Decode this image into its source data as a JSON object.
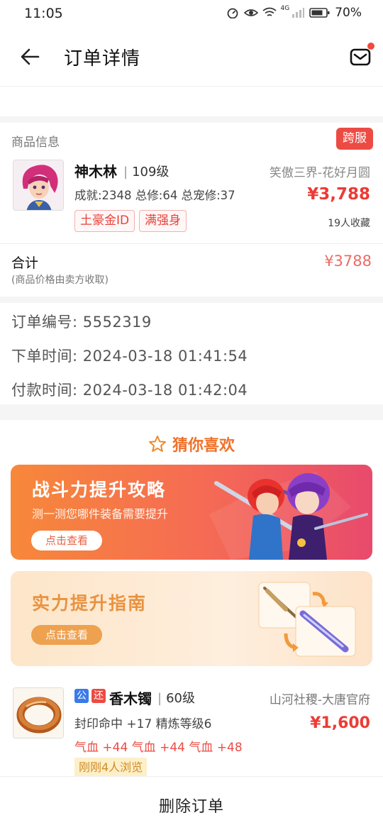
{
  "status_bar": {
    "time": "11:05",
    "network": "4G",
    "battery": "70%"
  },
  "header": {
    "title": "订单详情"
  },
  "product": {
    "section_label": "商品信息",
    "cross_badge": "跨服",
    "name": "神木林",
    "level": "109级",
    "server": "笑傲三界-花好月圆",
    "stats": "成就:2348 总修:64 总宠修:37",
    "price": "¥3,788",
    "tags": [
      "土豪金ID",
      "满强身"
    ],
    "favorites": "19人收藏"
  },
  "total": {
    "label": "合计",
    "note": "(商品价格由卖方收取)",
    "value": "¥3788"
  },
  "order_info": {
    "order_no": "订单编号:  5552319",
    "order_time": "下单时间:  2024-03-18 01:41:54",
    "pay_time": "付款时间:  2024-03-18 01:42:04"
  },
  "recommend": {
    "title": "猜你喜欢",
    "banners": [
      {
        "title": "战斗力提升攻略",
        "subtitle": "测一测您哪件装备需要提升",
        "button": "点击查看"
      },
      {
        "title": "实力提升指南",
        "button": "点击查看"
      }
    ],
    "item": {
      "badges": [
        "公",
        "还"
      ],
      "name": "香木镯",
      "level": "60级",
      "server": "山河社稷-大唐官府",
      "attrs": "封印命中 +17 精炼等级6",
      "price": "¥1,600",
      "extra": "气血 +44 气血 +44 气血 +48",
      "views": "刚刚4人浏览"
    }
  },
  "bottom": {
    "delete_label": "删除订单"
  },
  "colors": {
    "accent_red": "#ec3b35",
    "badge_blue": "#3a7be8",
    "badge_red": "#ec4b44",
    "recommend_orange": "#f07028"
  }
}
